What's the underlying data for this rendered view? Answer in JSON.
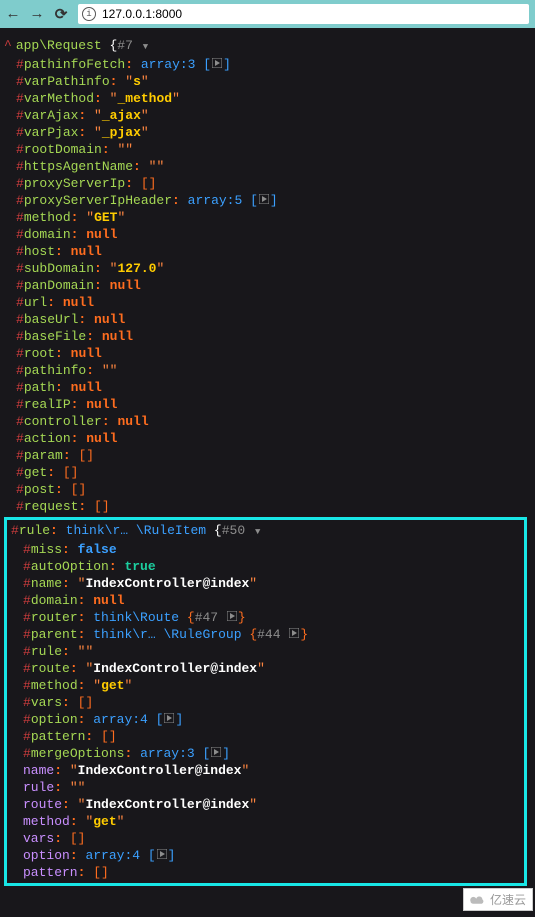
{
  "browser": {
    "url": "127.0.0.1:8000"
  },
  "root": {
    "class": "app\\Request",
    "count": "#7",
    "arrow": "▼"
  },
  "props": {
    "pathinfoFetch": {
      "name": "pathinfoFetch",
      "type": "arr",
      "val": "array:3"
    },
    "varPathinfo": {
      "name": "varPathinfo",
      "type": "str",
      "val": "s"
    },
    "varMethod": {
      "name": "varMethod",
      "type": "str",
      "val": "_method"
    },
    "varAjax": {
      "name": "varAjax",
      "type": "str",
      "val": "_ajax"
    },
    "varPjax": {
      "name": "varPjax",
      "type": "str",
      "val": "_pjax"
    },
    "rootDomain": {
      "name": "rootDomain",
      "type": "estr",
      "val": ""
    },
    "httpsAgentName": {
      "name": "httpsAgentName",
      "type": "estr",
      "val": ""
    },
    "proxyServerIp": {
      "name": "proxyServerIp",
      "type": "earr",
      "val": "[]"
    },
    "proxyServerIpHeader": {
      "name": "proxyServerIpHeader",
      "type": "arr",
      "val": "array:5"
    },
    "method": {
      "name": "method",
      "type": "str",
      "val": "GET"
    },
    "domain": {
      "name": "domain",
      "type": "null",
      "val": "null"
    },
    "host": {
      "name": "host",
      "type": "null",
      "val": "null"
    },
    "subDomain": {
      "name": "subDomain",
      "type": "str",
      "val": "127.0"
    },
    "panDomain": {
      "name": "panDomain",
      "type": "null",
      "val": "null"
    },
    "url": {
      "name": "url",
      "type": "null",
      "val": "null"
    },
    "baseUrl": {
      "name": "baseUrl",
      "type": "null",
      "val": "null"
    },
    "baseFile": {
      "name": "baseFile",
      "type": "null",
      "val": "null"
    },
    "root": {
      "name": "root",
      "type": "null",
      "val": "null"
    },
    "pathinfo": {
      "name": "pathinfo",
      "type": "estr",
      "val": ""
    },
    "path": {
      "name": "path",
      "type": "null",
      "val": "null"
    },
    "realIP": {
      "name": "realIP",
      "type": "null",
      "val": "null"
    },
    "controller": {
      "name": "controller",
      "type": "null",
      "val": "null"
    },
    "action": {
      "name": "action",
      "type": "null",
      "val": "null"
    },
    "param": {
      "name": "param",
      "type": "earr",
      "val": "[]"
    },
    "get": {
      "name": "get",
      "type": "earr",
      "val": "[]"
    },
    "post": {
      "name": "post",
      "type": "earr",
      "val": "[]"
    },
    "request": {
      "name": "request",
      "type": "earr",
      "val": "[]"
    }
  },
  "rule": {
    "header": {
      "name": "rule",
      "ns1": "think\\r…",
      "ns2": "\\RuleItem",
      "count": "#50",
      "arrow": "▼"
    },
    "props": {
      "miss": {
        "name": "miss",
        "type": "bool",
        "val": "false"
      },
      "autoOption": {
        "name": "autoOption",
        "type": "bool2",
        "val": "true"
      },
      "name": {
        "name": "name",
        "type": "strw",
        "val": "IndexController@index"
      },
      "domain": {
        "name": "domain",
        "type": "null",
        "val": "null"
      },
      "router": {
        "name": "router",
        "type": "obj",
        "ns": "think\\Route",
        "count": "#47"
      },
      "parent": {
        "name": "parent",
        "type": "obj",
        "ns1": "think\\r…",
        "ns2": "\\RuleGroup",
        "count": "#44"
      },
      "rule": {
        "name": "rule",
        "type": "estr",
        "val": ""
      },
      "route": {
        "name": "route",
        "type": "strw",
        "val": "IndexController@index"
      },
      "method": {
        "name": "method",
        "type": "str",
        "val": "get"
      },
      "vars": {
        "name": "vars",
        "type": "earr",
        "val": "[]"
      },
      "option": {
        "name": "option",
        "type": "arr",
        "val": "array:4"
      },
      "pattern": {
        "name": "pattern",
        "type": "earr",
        "val": "[]"
      },
      "mergeOptions": {
        "name": "mergeOptions",
        "type": "arr",
        "val": "array:3"
      }
    },
    "pub": {
      "name": {
        "name": "name",
        "val": "IndexController@index",
        "type": "strw"
      },
      "rule": {
        "name": "rule",
        "val": "",
        "type": "estr"
      },
      "route": {
        "name": "route",
        "val": "IndexController@index",
        "type": "strw"
      },
      "method": {
        "name": "method",
        "val": "get",
        "type": "str"
      },
      "vars": {
        "name": "vars",
        "val": "[]",
        "type": "earr"
      },
      "option": {
        "name": "option",
        "val": "array:4",
        "type": "arr"
      },
      "pattern": {
        "name": "pattern",
        "val": "[]",
        "type": "earr"
      }
    }
  },
  "watermark": "亿速云"
}
